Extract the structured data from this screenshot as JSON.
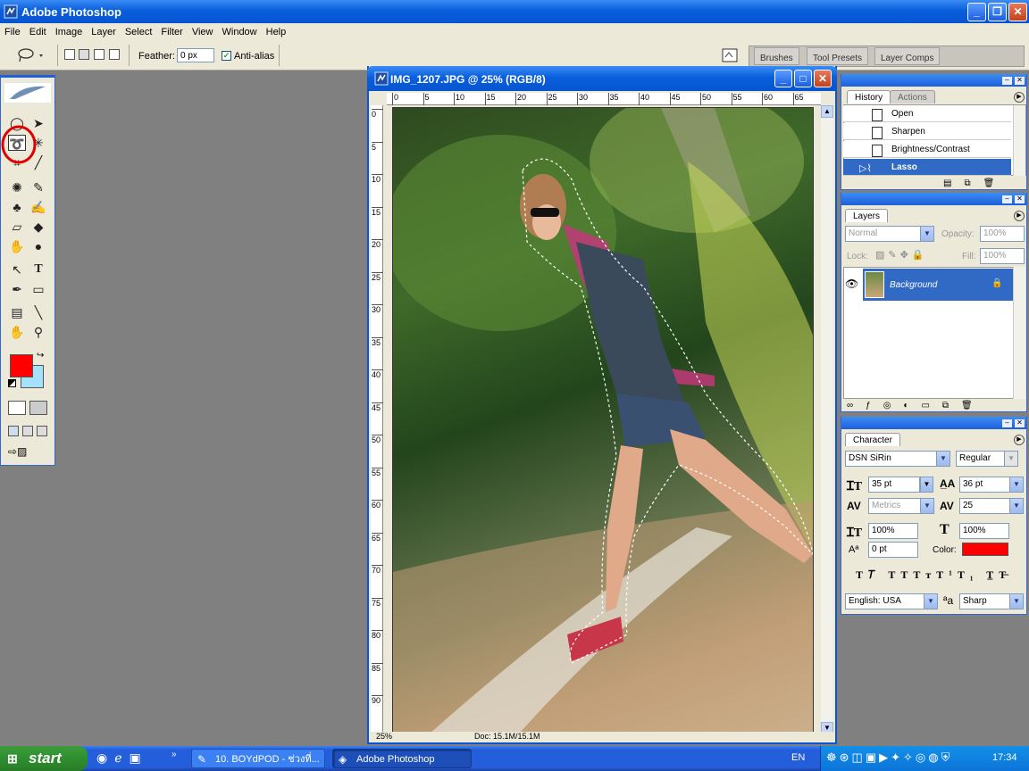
{
  "app": {
    "title": "Adobe Photoshop"
  },
  "menu": [
    "File",
    "Edit",
    "Image",
    "Layer",
    "Select",
    "Filter",
    "View",
    "Window",
    "Help"
  ],
  "options": {
    "feather_label": "Feather:",
    "feather_value": "0 px",
    "antialias_label": "Anti-alias",
    "antialias_checked": true
  },
  "palette_well_tabs": [
    "Brushes",
    "Tool Presets",
    "Layer Comps"
  ],
  "document": {
    "title": "IMG_1207.JPG @ 25% (RGB/8)",
    "ruler_h": [
      "0",
      "5",
      "10",
      "15",
      "20",
      "25",
      "30",
      "35",
      "40",
      "45",
      "50",
      "55",
      "60",
      "65"
    ],
    "ruler_v": [
      "0",
      "5",
      "10",
      "15",
      "20",
      "25",
      "30",
      "35",
      "40",
      "45",
      "50",
      "55",
      "60",
      "65",
      "70",
      "75",
      "80",
      "85",
      "90"
    ],
    "zoom": "25%",
    "doc_size": "Doc: 15.1M/15.1M"
  },
  "colors": {
    "foreground": "#ff0000",
    "background": "#a6e1fb",
    "selection": "#316ac5"
  },
  "history": {
    "tabs": [
      "History",
      "Actions"
    ],
    "items": [
      {
        "label": "Open"
      },
      {
        "label": "Sharpen"
      },
      {
        "label": "Brightness/Contrast"
      },
      {
        "label": "Lasso"
      }
    ],
    "selected_index": 3
  },
  "layers": {
    "tab": "Layers",
    "blend_mode": "Normal",
    "opacity_label": "Opacity:",
    "opacity_value": "100%",
    "lock_label": "Lock:",
    "fill_label": "Fill:",
    "fill_value": "100%",
    "items": [
      {
        "name": "Background",
        "locked": true,
        "visible": true
      }
    ]
  },
  "character": {
    "tab": "Character",
    "font_family": "DSN SiRin",
    "font_style": "Regular",
    "font_size": "35 pt",
    "leading": "36 pt",
    "kerning": "Metrics",
    "tracking": "25",
    "vertical_scale": "100%",
    "horizontal_scale": "100%",
    "baseline_shift": "0 pt",
    "color_label": "Color:",
    "color": "#ff0000",
    "language": "English: USA",
    "aa_label": "aa",
    "antialias": "Sharp"
  },
  "taskbar": {
    "start_label": "start",
    "tasks": [
      "10. BOYdPOD - ช่วงที่...",
      "Adobe Photoshop"
    ],
    "lang": "EN",
    "clock": "17:34"
  }
}
